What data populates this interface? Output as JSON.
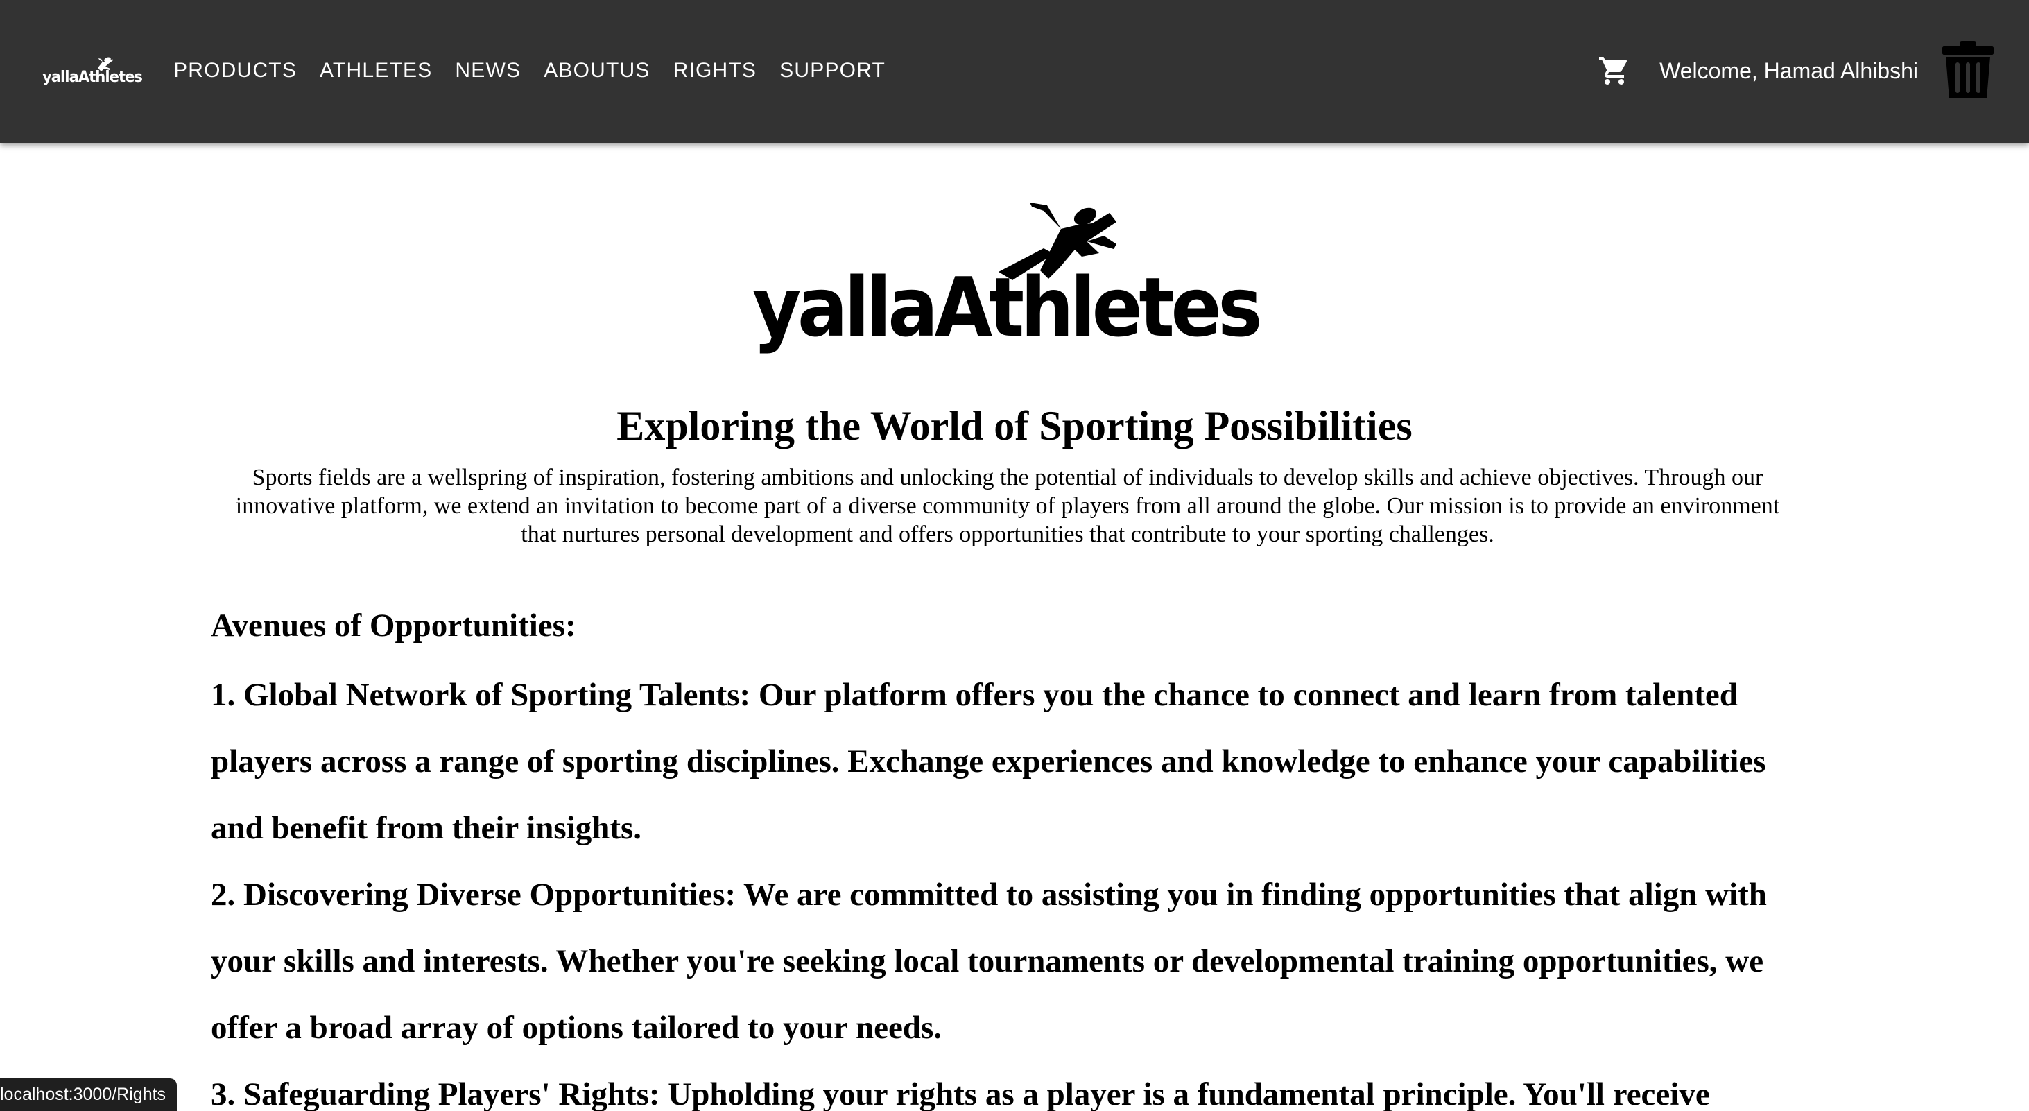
{
  "nav": {
    "logo_text": "yallaAthletes",
    "links": [
      "PRODUCTS",
      "ATHLETES",
      "NEWS",
      "ABOUTUS",
      "RIGHTS",
      "SUPPORT"
    ],
    "cart_icon": "shopping-cart-icon",
    "welcome_text": "Welcome, Hamad Alhibshi",
    "trash_icon": "trash-icon",
    "background_color": "#333333"
  },
  "hero": {
    "logo_text": "yallaAthletes",
    "title": "Exploring the World of Sporting Possibilities",
    "intro": "Sports fields are a wellspring of inspiration, fostering ambitions and unlocking the potential of individuals to develop skills and achieve objectives. Through our innovative platform, we extend an invitation to become part of a diverse community of players from all around the globe. Our mission is to provide an environment that nurtures personal development and offers opportunities that contribute to your sporting challenges."
  },
  "content": {
    "heading": "Avenues of Opportunities:",
    "items": [
      "1. Global Network of Sporting Talents: Our platform offers you the chance to connect and learn from talented players across a range of sporting disciplines. Exchange experiences and knowledge to enhance your capabilities and benefit from their insights.",
      "2. Discovering Diverse Opportunities: We are committed to assisting you in finding opportunities that align with your skills and interests. Whether you're seeking local tournaments or developmental training opportunities, we offer a broad array of options tailored to your needs.",
      "3. Safeguarding Players' Rights: Upholding your rights as a player is a fundamental principle. You'll receive"
    ]
  },
  "status_bar": {
    "url": "localhost:3000/Rights"
  }
}
